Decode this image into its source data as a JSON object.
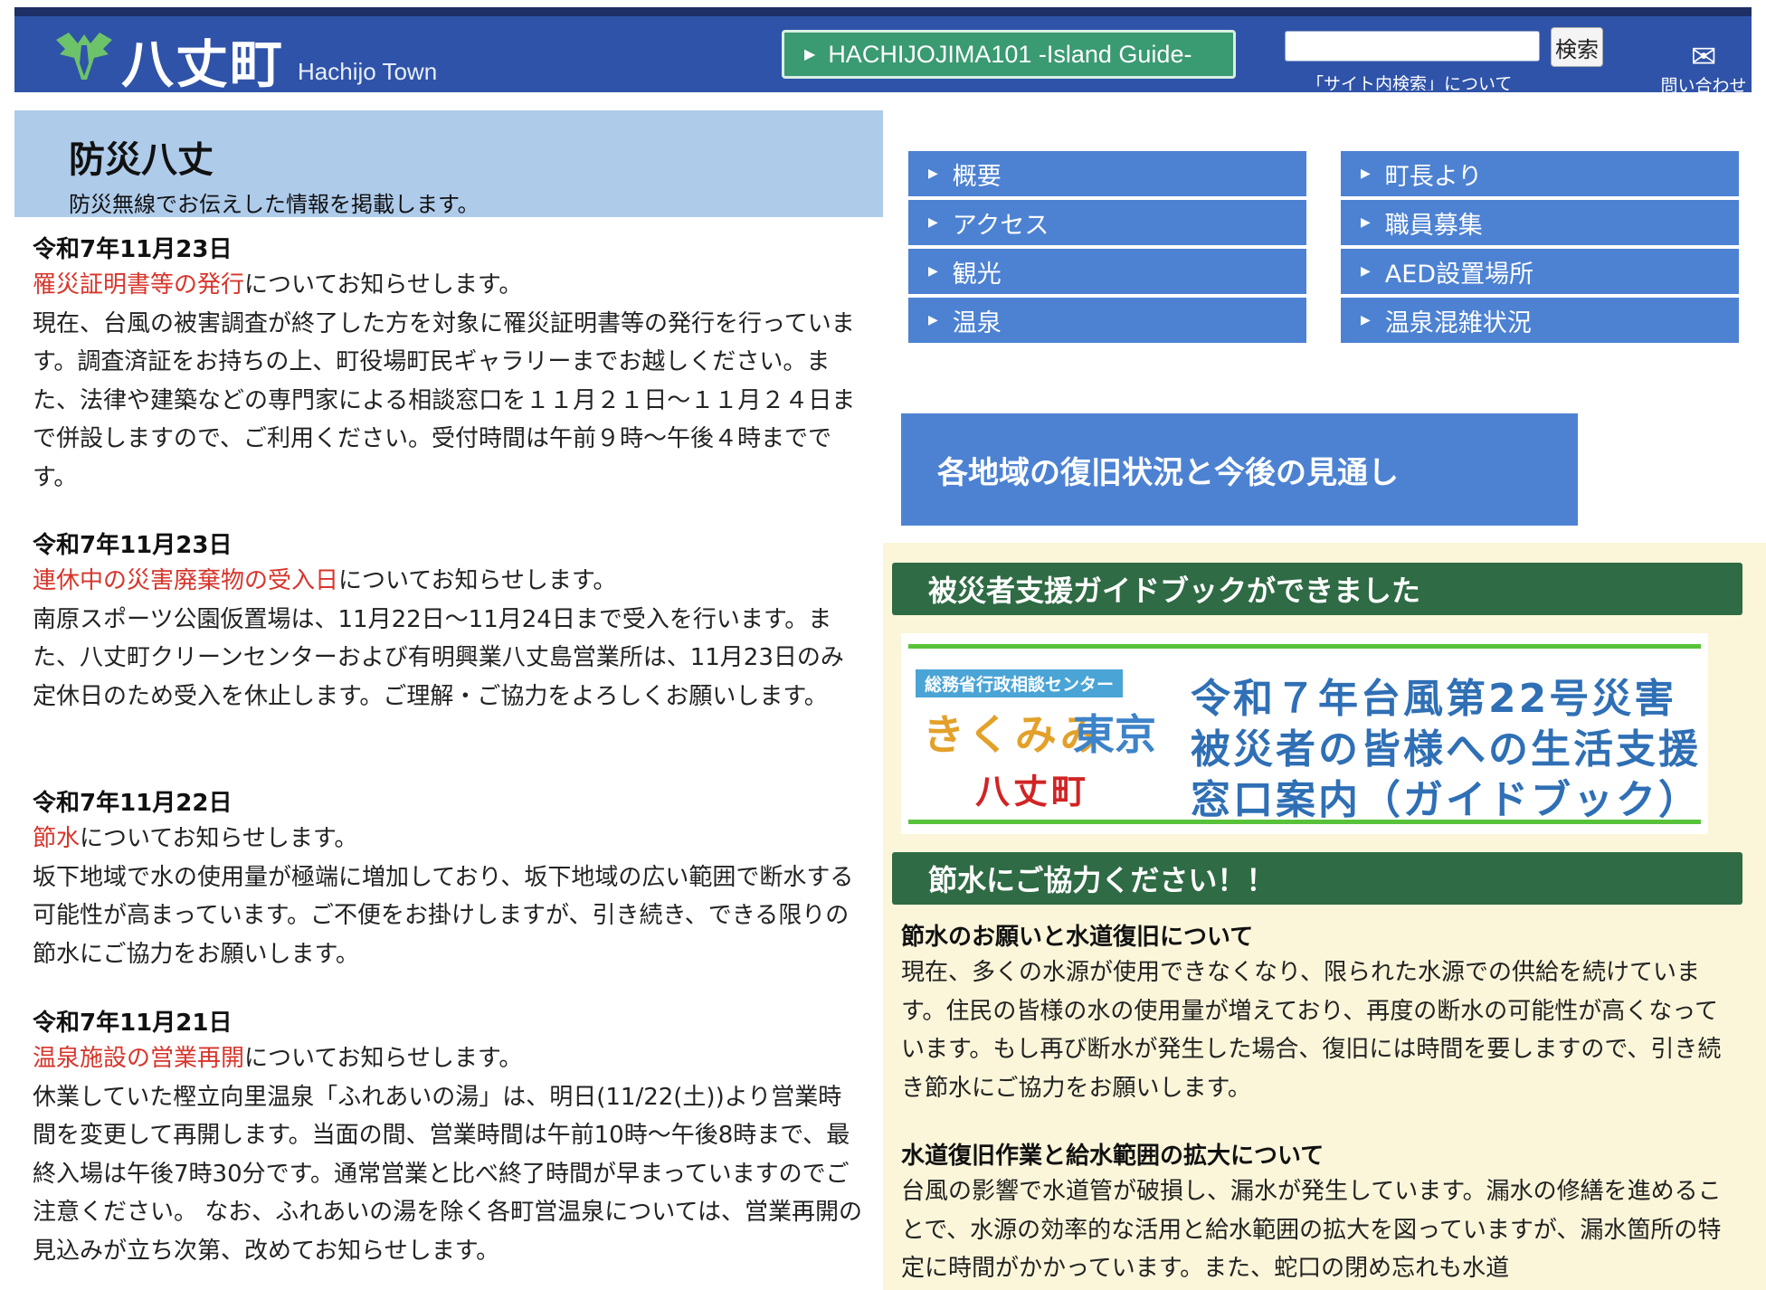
{
  "header": {
    "logo_text": "八丈町",
    "logo_sub": "Hachijo Town",
    "guide_button": "HACHIJOJIMA101 -Island Guide-",
    "search_placeholder": "",
    "search_button": "検索",
    "search_about": "「サイト内検索」について",
    "contact_label": "問い合わせ",
    "colors": {
      "header_bg": "#2f53a8",
      "guide_bg": "#3a9a72"
    }
  },
  "main": {
    "title": "防災八丈",
    "subtitle": "防災無線でお伝えした情報を掲載します。",
    "news": [
      {
        "date": "令和7年11月23日",
        "link": "罹災証明書等の発行",
        "link_suffix": "についてお知らせします。",
        "body": "現在、台風の被害調査が終了した方を対象に罹災証明書等の発行を行っています。調査済証をお持ちの上、町役場町民ギャラリーまでお越しください。また、法律や建築などの専門家による相談窓口を１１月２１日～１１月２４日まで併設しますので、ご利用ください。受付時間は午前９時～午後４時までです。"
      },
      {
        "date": "令和7年11月23日",
        "link": "連休中の災害廃棄物の受入日",
        "link_suffix": "についてお知らせします。",
        "body": "南原スポーツ公園仮置場は、11月22日～11月24日まで受入を行います。また、八丈町クリーンセンターおよび有明興業八丈島営業所は、11月23日のみ定休日のため受入を休止します。ご理解・ご協力をよろしくお願いします。"
      },
      {
        "date": "令和7年11月22日",
        "link": "節水",
        "link_suffix": "についてお知らせします。",
        "body": "坂下地域で水の使用量が極端に増加しており、坂下地域の広い範囲で断水する可能性が高まっています。ご不便をお掛けしますが、引き続き、できる限りの節水にご協力をお願いします。"
      },
      {
        "date": "令和7年11月21日",
        "link": "温泉施設の営業再開",
        "link_suffix": "についてお知らせします。",
        "body": "休業していた樫立向里温泉「ふれあいの湯」は、明日(11/22(土))より営業時間を変更して再開します。当面の間、営業時間は午前10時～午後8時まで、最終入場は午後7時30分です。通常営業と比べ終了時間が早まっていますのでご注意ください。 なお、ふれあいの湯を除く各町営温泉については、営業再開の見込みが立ち次第、改めてお知らせします。"
      }
    ]
  },
  "sidebar": {
    "nav_left": [
      "概要",
      "アクセス",
      "観光",
      "温泉"
    ],
    "nav_right": [
      "町長より",
      "職員募集",
      "AED設置場所",
      "温泉混雑状況"
    ],
    "recovery_button": "各地域の復旧状況と今後の見通し",
    "guidebook_heading": "被災者支援ガイドブックができました",
    "banner": {
      "agency": "総務省行政相談センター",
      "kikumi": "きくみみ",
      "tokyo": "東京",
      "town": "八丈町",
      "line1": "令和７年台風第22号災害",
      "line2": "被災者の皆様への生活支援",
      "line3": "窓口案内（ガイドブック）"
    },
    "water_heading": "節水にご協力ください！！",
    "water_blocks": [
      {
        "title": "節水のお願いと水道復旧について",
        "body": "現在、多くの水源が使用できなくなり、限られた水源での供給を続けています。住民の皆様の水の使用量が増えており、再度の断水の可能性が高くなっています。もし再び断水が発生した場合、復旧には時間を要しますので、引き続き節水にご協力をお願いします。"
      },
      {
        "title": "水道復旧作業と給水範囲の拡大について",
        "body": "台風の影響で水道管が破損し、漏水が発生しています。漏水の修繕を進めることで、水源の効率的な活用と給水範囲の拡大を図っていますが、漏水箇所の特定に時間がかかっています。また、蛇口の閉め忘れも水道"
      }
    ]
  }
}
